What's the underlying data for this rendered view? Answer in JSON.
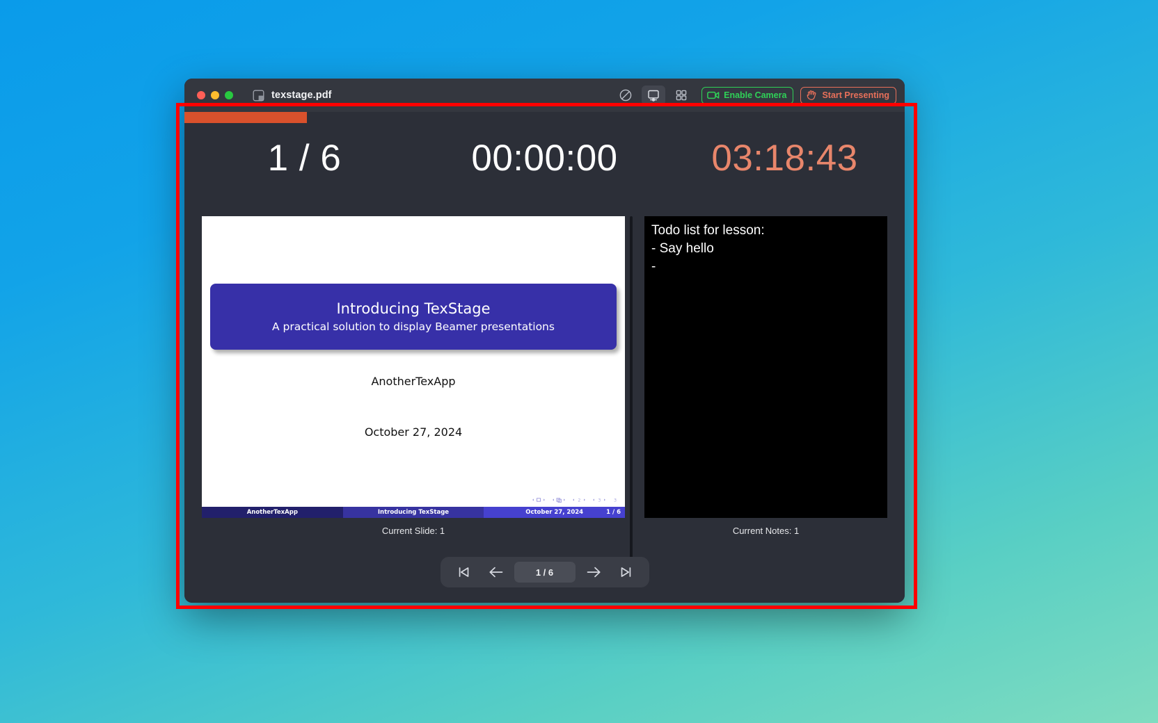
{
  "window": {
    "title": "texstage.pdf",
    "doc_icon": "pdf-page-icon",
    "traffic_lights": [
      "close",
      "minimize",
      "maximize"
    ]
  },
  "toolbar": {
    "icons": [
      {
        "name": "no-pointer-icon",
        "label": "Pointer Off",
        "active": false
      },
      {
        "name": "display-screen-icon",
        "label": "Display",
        "active": true
      },
      {
        "name": "grid-overview-icon",
        "label": "Slide Grid",
        "active": false
      }
    ],
    "camera_button": {
      "label": "Enable Camera",
      "icon": "video-camera-icon",
      "color": "#2fd157"
    },
    "present_button": {
      "label": "Start Presenting",
      "icon": "presenter-hand-icon",
      "color": "#e8705a"
    }
  },
  "progress": {
    "percent": 17,
    "color": "#d9512c"
  },
  "status": {
    "slide_counter": "1 / 6",
    "elapsed_timer": "00:00:00",
    "wall_clock": "03:18:43",
    "clock_color": "#e8866b"
  },
  "slide": {
    "title": "Introducing TexStage",
    "subtitle": "A practical solution to display Beamer presentations",
    "author": "AnotherTexApp",
    "date": "October 27, 2024",
    "titleblock_color": "#3730a8",
    "footline": {
      "left": "AnotherTexApp",
      "center": "Introducing  TexStage",
      "right": "October 27, 2024",
      "page": "1 / 6"
    },
    "caption": "Current Slide: 1"
  },
  "notes": {
    "text": "Todo list for lesson:\n- Say hello\n-",
    "caption": "Current Notes: 1"
  },
  "navbar": {
    "first_label": "First Slide",
    "prev_label": "Previous Slide",
    "page_value": "1 / 6",
    "next_label": "Next Slide",
    "last_label": "Last Slide"
  },
  "annotation": {
    "color": "#ff0000"
  }
}
